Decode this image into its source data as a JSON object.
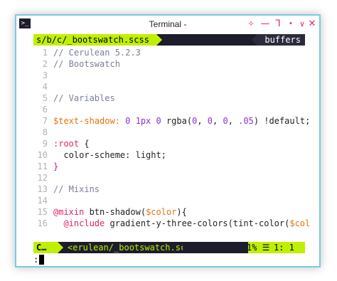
{
  "window": {
    "title": "Terminal -",
    "app_icon": ">_",
    "controls": [
      "✧",
      "—",
      "⅂",
      "•",
      "∨",
      "✕"
    ],
    "border_color": "#7ec8e3"
  },
  "tabline": {
    "active_tab": "s/b/c/_bootswatch.scss",
    "buffers_label": "buffers"
  },
  "code_lines": [
    {
      "n": "1",
      "parts": [
        {
          "t": "// Cerulean 5.2.3",
          "c": "comment"
        }
      ]
    },
    {
      "n": "2",
      "parts": [
        {
          "t": "// Bootswatch",
          "c": "comment"
        }
      ]
    },
    {
      "n": "3",
      "parts": []
    },
    {
      "n": "4",
      "parts": []
    },
    {
      "n": "5",
      "parts": [
        {
          "t": "// Variables",
          "c": "comment"
        }
      ]
    },
    {
      "n": "6",
      "parts": []
    },
    {
      "n": "7",
      "parts": [
        {
          "t": "$text-shadow:",
          "c": "var"
        },
        {
          "t": " 0 1px 0 ",
          "c": "num"
        },
        {
          "t": "rgba(",
          "c": "plain"
        },
        {
          "t": "0",
          "c": "num"
        },
        {
          "t": ", ",
          "c": "plain"
        },
        {
          "t": "0",
          "c": "num"
        },
        {
          "t": ", ",
          "c": "plain"
        },
        {
          "t": "0",
          "c": "num"
        },
        {
          "t": ", ",
          "c": "plain"
        },
        {
          "t": ".05",
          "c": "num"
        },
        {
          "t": ") !default;",
          "c": "plain"
        }
      ]
    },
    {
      "n": "8",
      "parts": []
    },
    {
      "n": "9",
      "parts": [
        {
          "t": ":root",
          "c": "kw"
        },
        {
          "t": " {",
          "c": "plain"
        }
      ]
    },
    {
      "n": "10",
      "parts": [
        {
          "t": "  color-scheme: light;",
          "c": "plain"
        }
      ]
    },
    {
      "n": "11",
      "parts": [
        {
          "t": "}",
          "c": "sel"
        }
      ]
    },
    {
      "n": "12",
      "parts": []
    },
    {
      "n": "13",
      "parts": [
        {
          "t": "// Mixins",
          "c": "comment"
        }
      ]
    },
    {
      "n": "14",
      "parts": []
    },
    {
      "n": "15",
      "parts": [
        {
          "t": "@mixin",
          "c": "kw"
        },
        {
          "t": " btn-shadow(",
          "c": "plain"
        },
        {
          "t": "$color",
          "c": "var"
        },
        {
          "t": "){",
          "c": "plain"
        }
      ]
    },
    {
      "n": "16",
      "parts": [
        {
          "t": "  @include",
          "c": "kw"
        },
        {
          "t": " gradient-y-three-colors(tint-color(",
          "c": "plain"
        },
        {
          "t": "$col",
          "c": "var"
        }
      ]
    }
  ],
  "statusline": {
    "mode": "C…",
    "filename": "<erulean/_bootswatch.scss",
    "percent": "1% ☰",
    "position": "1:  1"
  },
  "cmdline": {
    "text": ":"
  },
  "colors": {
    "accent": "#bff000",
    "dark": "#1c1c2b",
    "keyword": "#e0246a",
    "variable": "#e8710a",
    "number": "#8833cc",
    "comment": "#7a7f99"
  }
}
